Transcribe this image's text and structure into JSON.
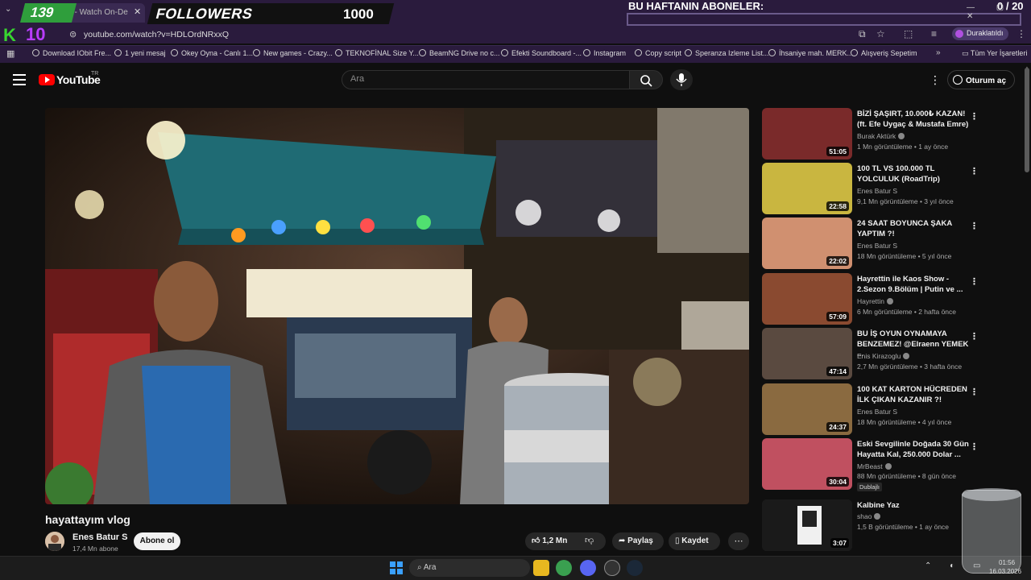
{
  "overlay": {
    "count": "139",
    "followers_label": "FOLLOWERS",
    "followers_value": "1000",
    "weekly_title": "BU HAFTANIN ABONELER:",
    "weekly_count": "0 / 20",
    "logo_k": "K",
    "logo_num": "10"
  },
  "browser": {
    "tab_title": "deos - Watch On-De",
    "url": "youtube.com/watch?v=HDLOrdNRxxQ",
    "profile_label": "Duraklatıldı",
    "bookmarks": [
      "Download IObit Fre...",
      "1 yeni mesaj",
      "Okey Oyna - Canlı 1...",
      "New games - Crazy...",
      "TEKNOFİNAL Size Y...",
      "BeamNG Drive no c...",
      "Efekti Soundboard -...",
      "Instagram",
      "Copy script",
      "Speranza Izleme List...",
      "İhsaniye mah. MERK...",
      "Alışveriş Sepetim"
    ],
    "all_bookmarks": "Tüm Yer İşaretleri"
  },
  "youtube": {
    "wordmark": "YouTube",
    "country": "TR",
    "search_placeholder": "Ara",
    "signin_label": "Oturum aç"
  },
  "video": {
    "title": "hayattayım vlog",
    "channel": "Enes Batur S",
    "subscribers": "17,4 Mn abone",
    "subscribe_label": "Abone ol",
    "likes": "1,2 Mn",
    "share_label": "Paylaş",
    "save_label": "Kaydet"
  },
  "recommendations": [
    {
      "title": "BİZİ ŞAŞIRT, 10.000₺ KAZAN! (ft. Efe Uygaç & Mustafa Emre)",
      "channel": "Burak Aktürk",
      "meta": "1 Mn görüntüleme • 1 ay önce",
      "duration": "51:05",
      "color": "#7a2a2a"
    },
    {
      "title": "100 TL VS 100.000 TL YOLCULUK (RoadTrip)",
      "channel": "Enes Batur S",
      "meta": "9,1 Mn görüntüleme • 3 yıl önce",
      "duration": "22:58",
      "color": "#c9b640"
    },
    {
      "title": "24 SAAT BOYUNCA ŞAKA YAPTIM ?!",
      "channel": "Enes Batur S",
      "meta": "18 Mn görüntüleme • 5 yıl önce",
      "duration": "22:02",
      "color": "#d09070"
    },
    {
      "title": "Hayrettin ile Kaos Show - 2.Sezon 9.Bölüm | Putin ve ...",
      "channel": "Hayrettin",
      "meta": "6 Mn görüntüleme • 2 hafta önce",
      "duration": "57:09",
      "color": "#8a4a30"
    },
    {
      "title": "BU İŞ OYUN OYNAMAYA BENZEMEZ! @Elraenn YEMEK ...",
      "channel": "Enis Kirazoglu",
      "meta": "2,7 Mn görüntüleme • 3 hafta önce",
      "duration": "47:14",
      "color": "#5a4a40"
    },
    {
      "title": "100 KAT KARTON HÜCREDEN İLK ÇIKAN KAZANIR ?!",
      "channel": "Enes Batur S",
      "meta": "18 Mn görüntüleme • 4 yıl önce",
      "duration": "24:37",
      "color": "#8a6a40"
    },
    {
      "title": "Eski Sevgilinle Doğada 30 Gün Hayatta Kal, 250.000 Dolar ...",
      "channel": "MrBeast",
      "meta": "88 Mn görüntüleme • 8 gün önce",
      "duration": "30:04",
      "badge": "Dublajlı",
      "color": "#c05060"
    },
    {
      "title": "Kalbine Yaz",
      "channel": "shao",
      "meta": "1,5 B görüntüleme • 1 ay önce",
      "duration": "3:07",
      "color": "#222"
    }
  ],
  "taskbar": {
    "search_placeholder": "Ara",
    "time": "01:56",
    "date": "16.03.2026"
  }
}
